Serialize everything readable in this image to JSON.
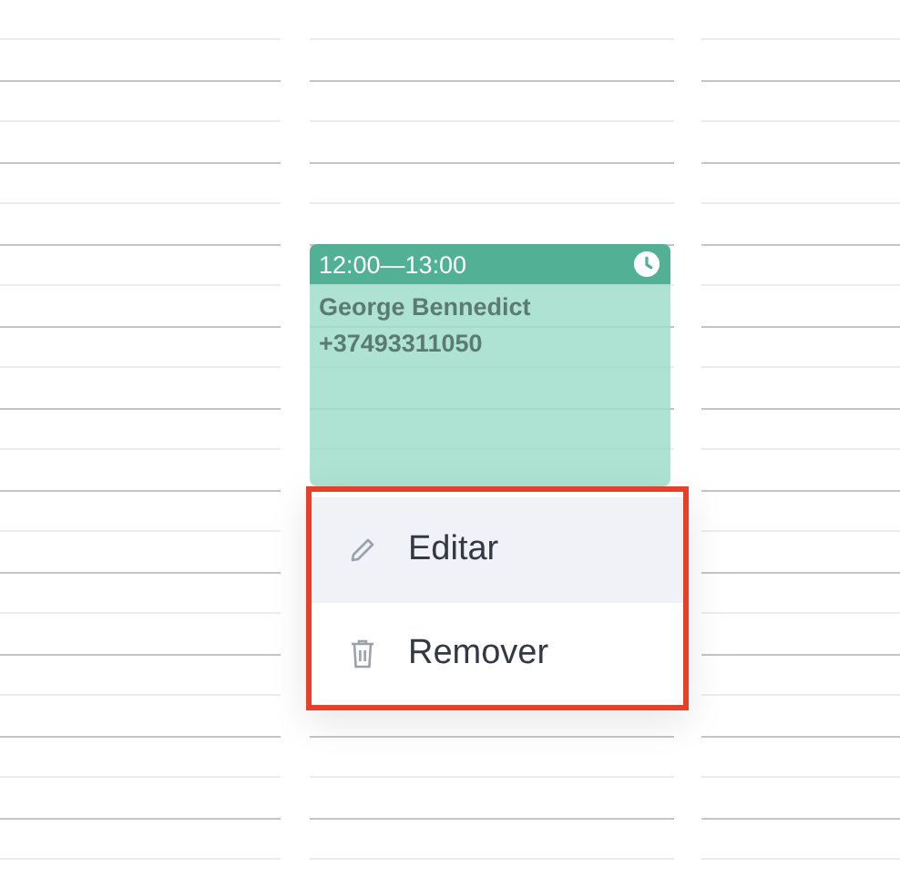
{
  "event": {
    "time": "12:00—13:00",
    "name": "George Bennedict",
    "phone": "+37493311050"
  },
  "menu": {
    "items": [
      {
        "label": "Editar",
        "kind": "edit",
        "selected": true
      },
      {
        "label": "Remover",
        "kind": "delete",
        "selected": false
      }
    ]
  }
}
